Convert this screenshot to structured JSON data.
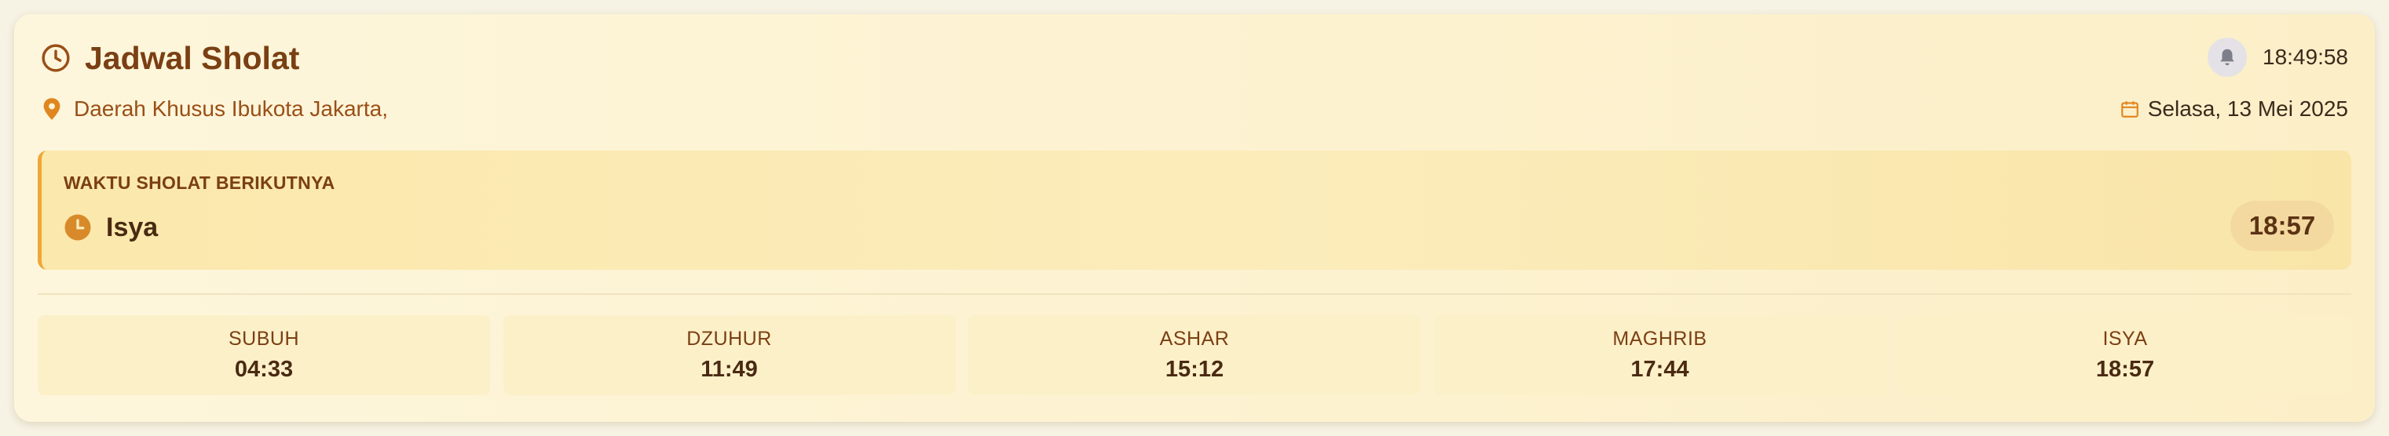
{
  "header": {
    "title": "Jadwal Sholat",
    "location": "Daerah Khusus Ibukota Jakarta,",
    "current_time": "18:49:58",
    "date": "Selasa, 13 Mei 2025"
  },
  "next_prayer": {
    "label": "WAKTU SHOLAT BERIKUTNYA",
    "name": "Isya",
    "time": "18:57"
  },
  "prayers": [
    {
      "name": "SUBUH",
      "time": "04:33"
    },
    {
      "name": "DZUHUR",
      "time": "11:49"
    },
    {
      "name": "ASHAR",
      "time": "15:12"
    },
    {
      "name": "MAGHRIB",
      "time": "17:44"
    },
    {
      "name": "ISYA",
      "time": "18:57"
    }
  ],
  "icons": {
    "title": "clock-icon",
    "location": "map-pin-icon",
    "notification": "bell-icon",
    "date": "calendar-icon",
    "next_prayer": "clock-filled-icon"
  },
  "colors": {
    "title": "#7a3f13",
    "accent": "#f0a637",
    "location": "#9a4f17",
    "card_bg": "#fdf4d4",
    "highlight_bg": "#fbe8ac"
  }
}
